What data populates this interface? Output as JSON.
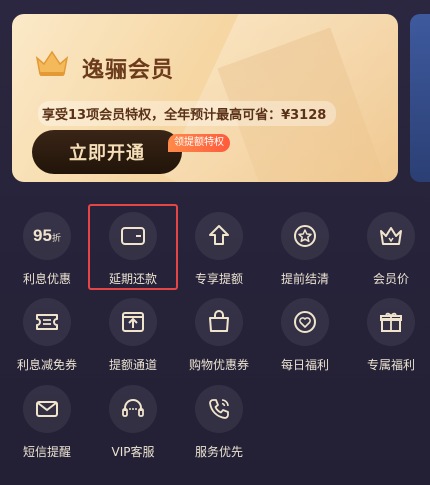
{
  "membership": {
    "title": "逸骊会员",
    "subtitle": "享受13项会员特权，全年预计最高可省：¥3128",
    "button_label": "立即开通",
    "badge": "领提额特权"
  },
  "benefits": [
    {
      "label": "利息优惠",
      "icon": "discount-95-icon",
      "icon_text": "95",
      "icon_sub": "折"
    },
    {
      "label": "延期还款",
      "icon": "wallet-card-icon"
    },
    {
      "label": "专享提额",
      "icon": "up-arrow-icon"
    },
    {
      "label": "提前结清",
      "icon": "star-circle-icon"
    },
    {
      "label": "会员价",
      "icon": "crown-icon"
    },
    {
      "label": "利息减免券",
      "icon": "coupon-icon"
    },
    {
      "label": "提额通道",
      "icon": "upload-box-icon"
    },
    {
      "label": "购物优惠券",
      "icon": "shopping-bag-icon"
    },
    {
      "label": "每日福利",
      "icon": "heart-circle-icon"
    },
    {
      "label": "专属福利",
      "icon": "gift-icon"
    },
    {
      "label": "短信提醒",
      "icon": "mail-icon"
    },
    {
      "label": "VIP客服",
      "icon": "headset-icon"
    },
    {
      "label": "服务优先",
      "icon": "phone-icon"
    }
  ],
  "colors": {
    "highlight": "#e64545",
    "accent": "#f6d7a4",
    "background": "#27233a"
  }
}
